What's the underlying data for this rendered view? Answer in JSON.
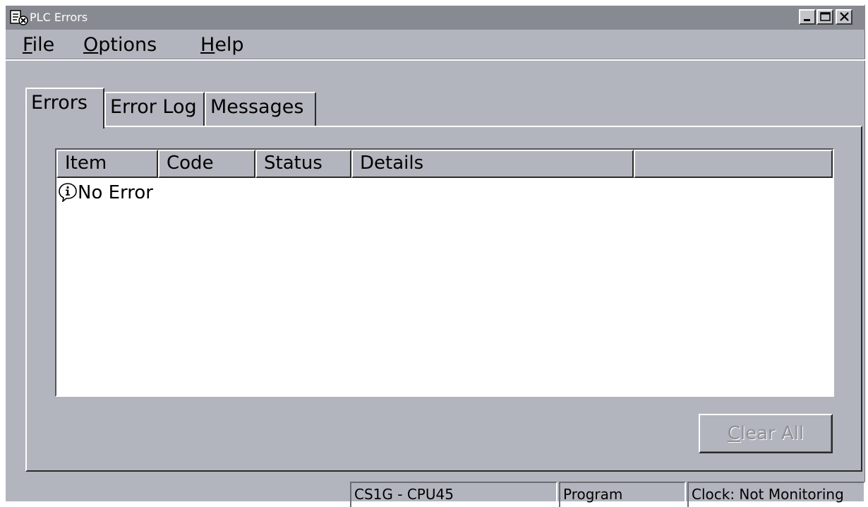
{
  "window": {
    "title": "PLC Errors"
  },
  "menu": {
    "file": {
      "accel": "F",
      "rest": "ile"
    },
    "options": {
      "accel": "O",
      "rest": "ptions"
    },
    "help": {
      "accel": "H",
      "rest": "elp"
    }
  },
  "tabs": [
    {
      "label": "Errors",
      "active": true
    },
    {
      "label": "Error Log",
      "active": false
    },
    {
      "label": "Messages",
      "active": false
    }
  ],
  "table": {
    "columns": [
      "Item",
      "Code",
      "Status",
      "Details",
      ""
    ],
    "rows": [
      {
        "icon": "info-icon",
        "item": "No Error",
        "code": "",
        "status": "",
        "details": ""
      }
    ]
  },
  "clear_button": {
    "accel": "C",
    "rest": "lear All",
    "enabled": false
  },
  "statusbar": {
    "model": "CS1G - CPU45",
    "mode": "Program",
    "clock": "Clock: Not Monitoring"
  }
}
